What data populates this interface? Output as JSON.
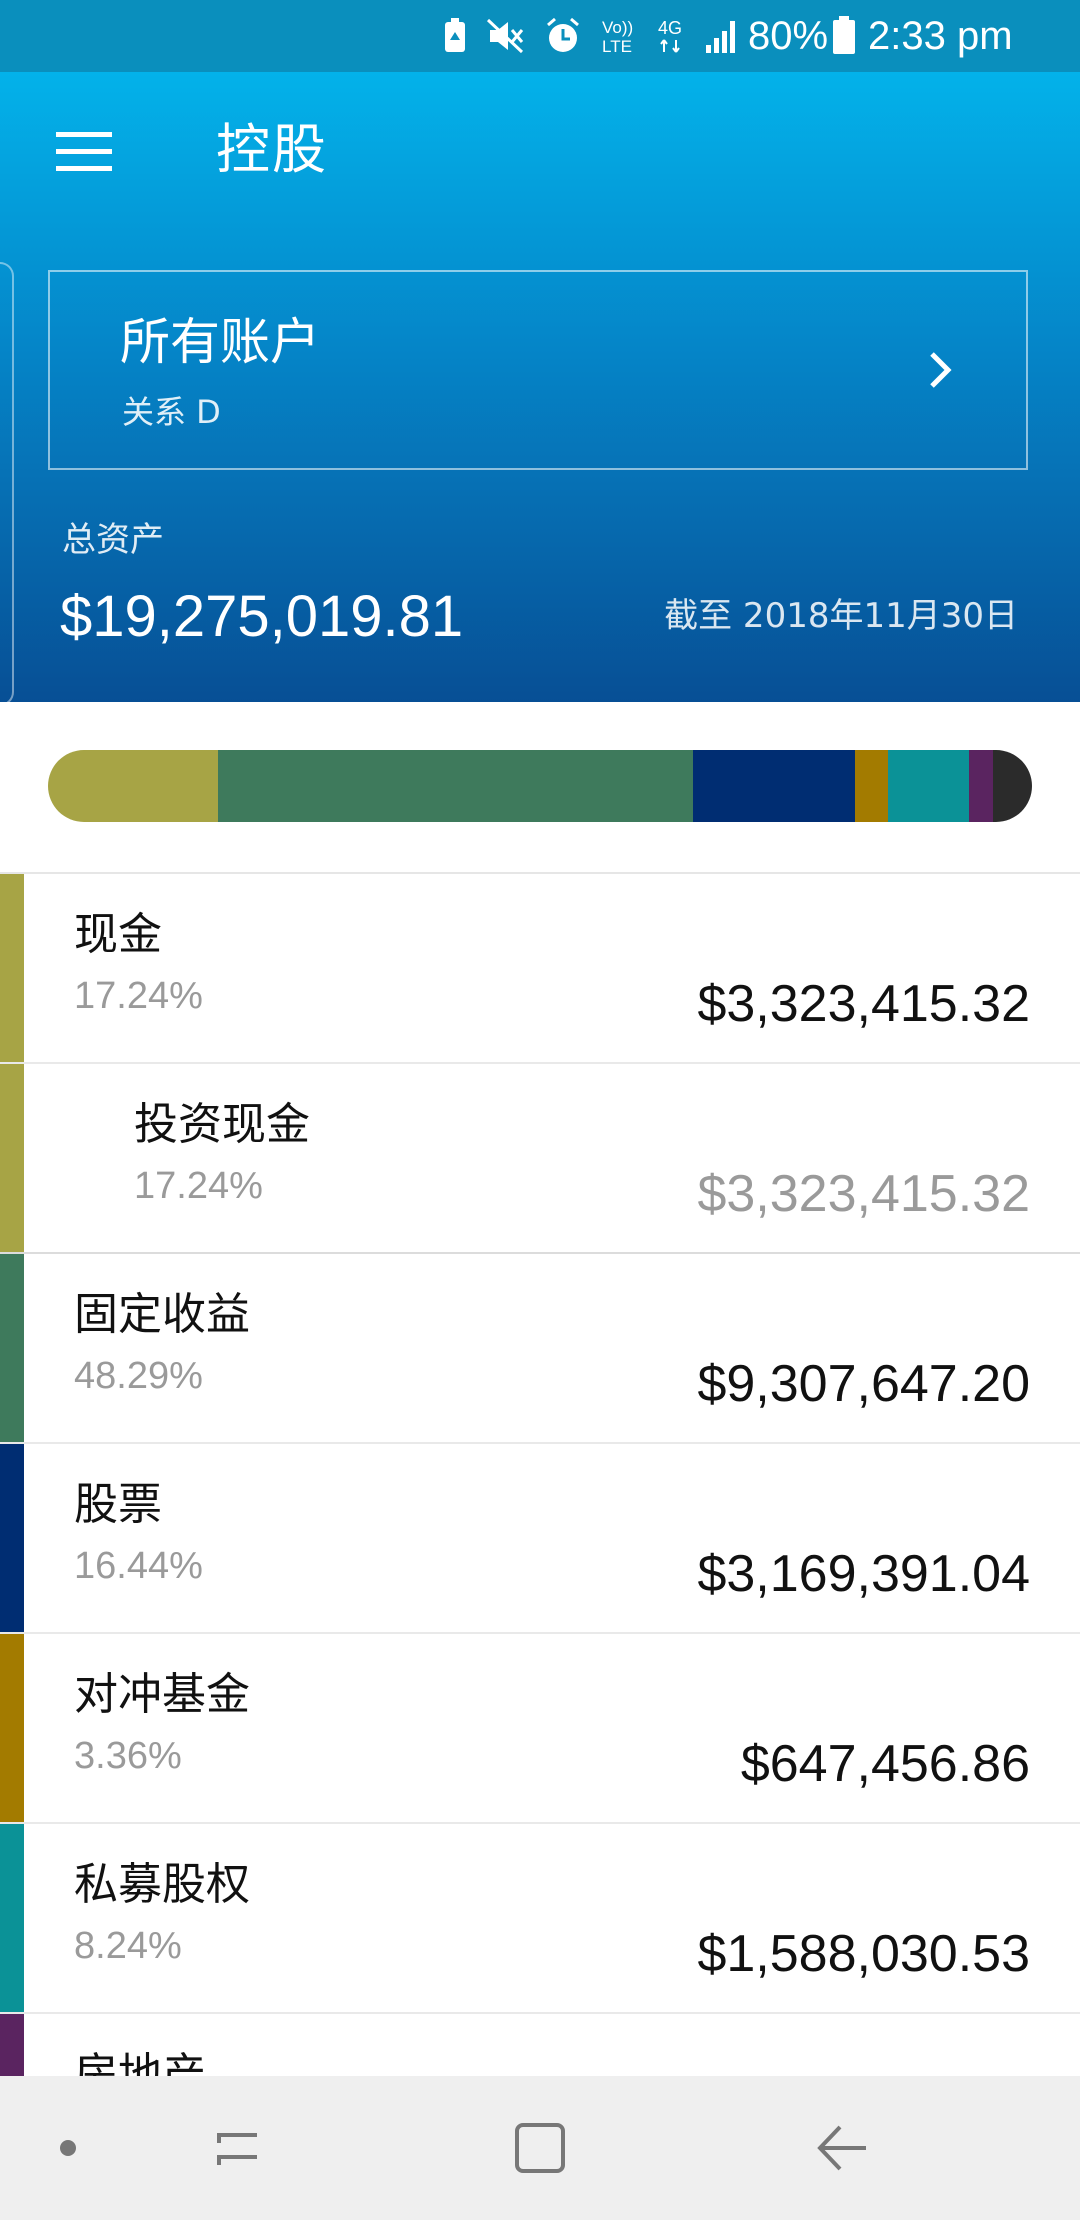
{
  "status_bar": {
    "battery_percent": "80%",
    "time": "2:33 pm",
    "network": "4G",
    "volte": "Vo)) LTE",
    "icons": [
      "battery-saver-icon",
      "mute-icon",
      "alarm-icon",
      "volte-icon",
      "network-4g-icon",
      "signal-icon",
      "battery-icon"
    ]
  },
  "header": {
    "title": "控股",
    "menu_icon": "menu-icon",
    "account": {
      "name": "所有账户",
      "relationship": "关系 D",
      "chevron_icon": "chevron-right-icon"
    },
    "total_label": "总资产",
    "total_value": "$19,275,019.81",
    "as_of": "截至 2018年11月30日"
  },
  "allocation_bar": [
    {
      "name": "现金",
      "fraction": 0.1724,
      "color": "#a7a445"
    },
    {
      "name": "固定收益",
      "fraction": 0.4829,
      "color": "#3e7a5c"
    },
    {
      "name": "股票",
      "fraction": 0.1644,
      "color": "#002d72"
    },
    {
      "name": "对冲基金",
      "fraction": 0.0336,
      "color": "#a37b00"
    },
    {
      "name": "私募股权",
      "fraction": 0.0824,
      "color": "#0b9297"
    },
    {
      "name": "房地产",
      "fraction": 0.025,
      "color": "#5a2460"
    },
    {
      "name": "other",
      "fraction": 0.0393,
      "color": "#2b2b2b"
    }
  ],
  "holdings": [
    {
      "name": "现金",
      "percent": "17.24%",
      "value": "$3,323,415.32",
      "color": "#a7a445"
    },
    {
      "name": "投资现金",
      "percent": "17.24%",
      "value": "$3,323,415.32",
      "color": "#a7a445"
    },
    {
      "name": "固定收益",
      "percent": "48.29%",
      "value": "$9,307,647.20",
      "color": "#3e7a5c"
    },
    {
      "name": "股票",
      "percent": "16.44%",
      "value": "$3,169,391.04",
      "color": "#002d72"
    },
    {
      "name": "对冲基金",
      "percent": "3.36%",
      "value": "$647,456.86",
      "color": "#a37b00"
    },
    {
      "name": "私募股权",
      "percent": "8.24%",
      "value": "$1,588,030.53",
      "color": "#0b9297"
    },
    {
      "name": "房地产",
      "color": "#5a2460"
    }
  ],
  "nav_bar": {
    "icons": [
      "nav-dot-icon",
      "recent-apps-icon",
      "home-icon",
      "back-icon"
    ]
  }
}
